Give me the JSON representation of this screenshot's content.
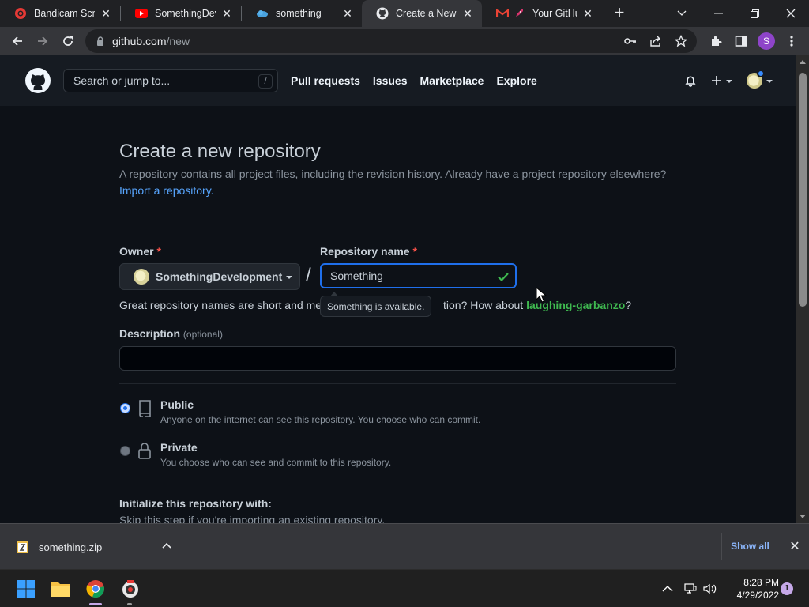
{
  "browser": {
    "tabs": [
      {
        "title": "Bandicam Screen",
        "icon": "bandicam-icon",
        "active": false
      },
      {
        "title": "SomethingDev",
        "icon": "youtube-icon",
        "active": false
      },
      {
        "title": "something",
        "icon": "cloud-icon",
        "active": false
      },
      {
        "title": "Create a New Re",
        "icon": "github-icon",
        "active": true
      },
      {
        "title": "Your GitHub",
        "icon": "gmail-icon",
        "active": false
      }
    ],
    "url_host": "github.com",
    "url_path": "/new",
    "profile_initial": "S"
  },
  "github": {
    "search_placeholder": "Search or jump to...",
    "search_shortcut": "/",
    "nav": [
      "Pull requests",
      "Issues",
      "Marketplace",
      "Explore"
    ]
  },
  "form": {
    "title": "Create a new repository",
    "lead": "A repository contains all project files, including the revision history. Already have a project repository elsewhere?",
    "import_link": "Import a repository.",
    "owner_label": "Owner",
    "repo_label": "Repository name",
    "required_mark": "*",
    "owner_value": "SomethingDevelopment",
    "separator": "/",
    "repo_value": "Something",
    "availability_tooltip": "Something is available.",
    "hint_prefix": "Great repository names are short and me",
    "hint_middle": "tion? How about ",
    "hint_suggestion": "laughing-garbanzo",
    "hint_suffix": "?",
    "description_label": "Description",
    "description_optional": "(optional)",
    "description_value": "",
    "visibility": [
      {
        "title": "Public",
        "description": "Anyone on the internet can see this repository. You choose who can commit.",
        "selected": true
      },
      {
        "title": "Private",
        "description": "You choose who can see and commit to this repository.",
        "selected": false
      }
    ],
    "init_title": "Initialize this repository with:",
    "init_subtitle": "Skip this step if you're importing an existing repository."
  },
  "downloads": {
    "file": "something.zip",
    "show_all": "Show all"
  },
  "taskbar": {
    "time": "8:28 PM",
    "date": "4/29/2022",
    "notifications": "1"
  },
  "colors": {
    "accent_blue": "#1f6feb",
    "link_blue": "#58a6ff",
    "success_green": "#3fb950",
    "required_red": "#f85149",
    "page_bg": "#0d1117",
    "header_bg": "#161b22"
  }
}
